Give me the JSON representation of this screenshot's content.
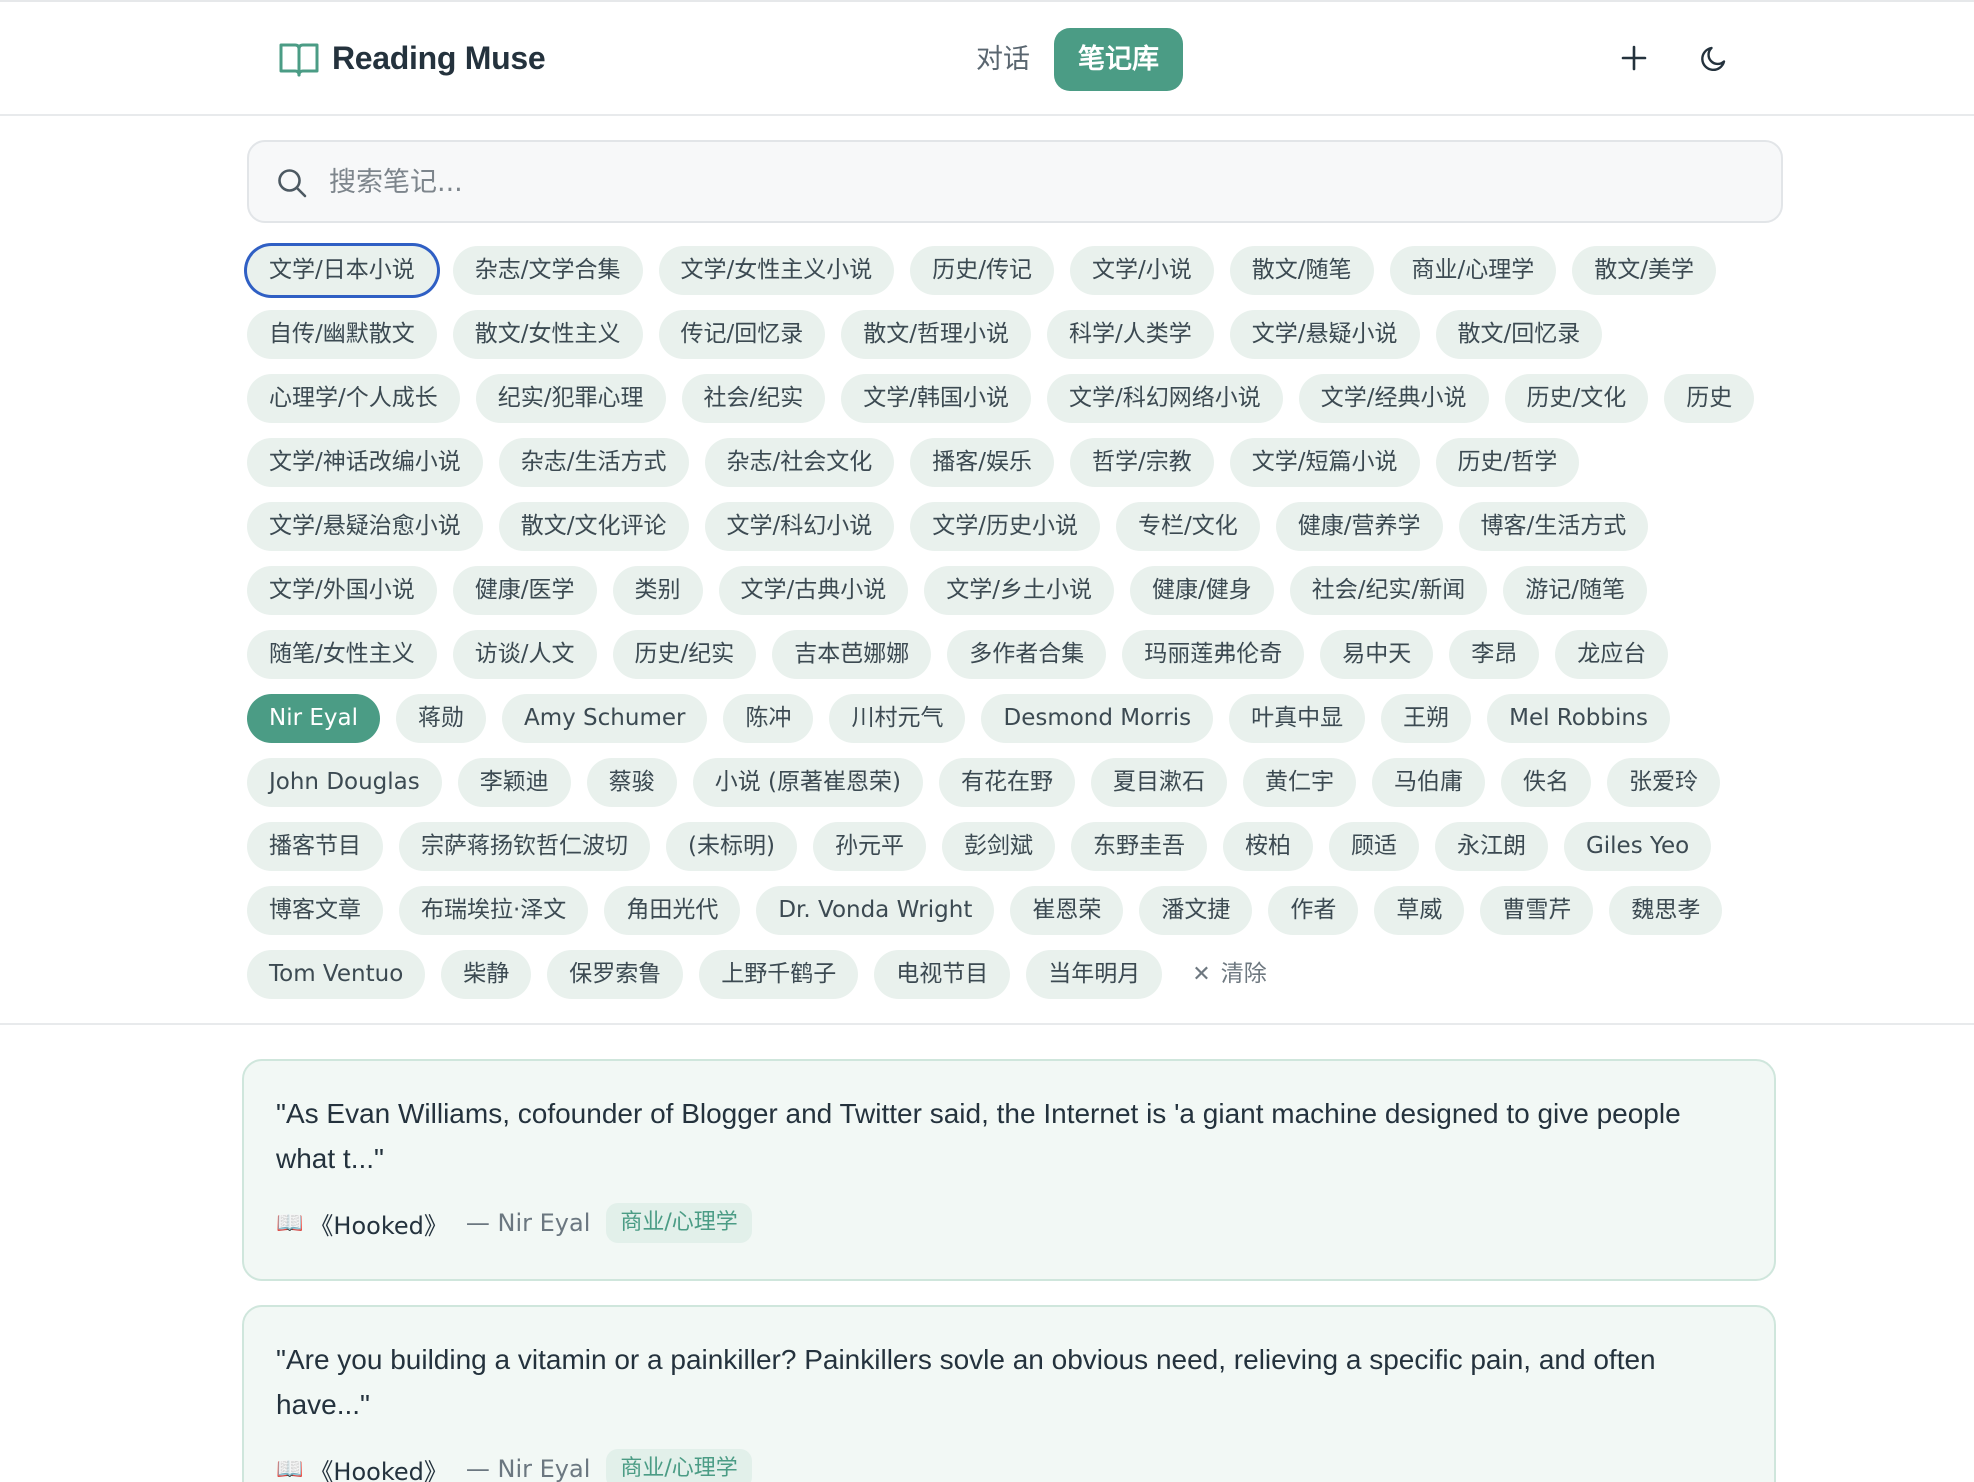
{
  "app": {
    "title": "Reading Muse"
  },
  "nav": {
    "chat": "对话",
    "notes": "笔记库"
  },
  "search": {
    "placeholder": "搜索笔记..."
  },
  "tags": [
    "文学/日本小说",
    "杂志/文学合集",
    "文学/女性主义小说",
    "历史/传记",
    "文学/小说",
    "散文/随笔",
    "商业/心理学",
    "散文/美学",
    "自传/幽默散文",
    "散文/女性主义",
    "传记/回忆录",
    "散文/哲理小说",
    "科学/人类学",
    "文学/悬疑小说",
    "散文/回忆录",
    "心理学/个人成长",
    "纪实/犯罪心理",
    "社会/纪实",
    "文学/韩国小说",
    "文学/科幻网络小说",
    "文学/经典小说",
    "历史/文化",
    "历史",
    "文学/神话改编小说",
    "杂志/生活方式",
    "杂志/社会文化",
    "播客/娱乐",
    "哲学/宗教",
    "文学/短篇小说",
    "历史/哲学",
    "文学/悬疑治愈小说",
    "散文/文化评论",
    "文学/科幻小说",
    "文学/历史小说",
    "专栏/文化",
    "健康/营养学",
    "博客/生活方式",
    "文学/外国小说",
    "健康/医学",
    "类别",
    "文学/古典小说",
    "文学/乡土小说",
    "健康/健身",
    "社会/纪实/新闻",
    "游记/随笔",
    "随笔/女性主义",
    "访谈/人文",
    "历史/纪实",
    "吉本芭娜娜",
    "多作者合集",
    "玛丽莲弗伦奇",
    "易中天",
    "李昂",
    "龙应台",
    "Nir Eyal",
    "蒋勋",
    "Amy Schumer",
    "陈冲",
    "川村元气",
    "Desmond Morris",
    "叶真中显",
    "王朔",
    "Mel Robbins",
    "John Douglas",
    "李颖迪",
    "蔡骏",
    "小说 (原著崔恩荣)",
    "有花在野",
    "夏目漱石",
    "黄仁宇",
    "马伯庸",
    "佚名",
    "张爱玲",
    "播客节目",
    "宗萨蒋扬钦哲仁波切",
    "(未标明)",
    "孙元平",
    "彭剑斌",
    "东野圭吾",
    "桉柏",
    "顾适",
    "永江朗",
    "Giles Yeo",
    "博客文章",
    "布瑞埃拉·泽文",
    "角田光代",
    "Dr. Vonda Wright",
    "崔恩荣",
    "潘文捷",
    "作者",
    "草威",
    "曹雪芹",
    "魏思孝",
    "Tom Ventuo",
    "柴静",
    "保罗索鲁",
    "上野千鹤子",
    "电视节目",
    "当年明月"
  ],
  "selected_tag": "Nir Eyal",
  "focused_tag": "文学/日本小说",
  "clear_label": "清除",
  "notes": [
    {
      "quote": "\"As Evan Williams, cofounder of Blogger and Twitter said, the Internet is 'a giant machine designed to give people what t...\"",
      "book": "《Hooked》",
      "author": "— Nir Eyal",
      "tag": "商业/心理学"
    },
    {
      "quote": "\"Are you building a vitamin or a painkiller? Painkillers sovle an obvious need, relieving a specific pain, and often have...\"",
      "book": "《Hooked》",
      "author": "— Nir Eyal",
      "tag": "商业/心理学"
    }
  ],
  "colors": {
    "accent": "#4b9c85",
    "tag_bg": "#e9f1ed",
    "card_bg": "#f2f8f5",
    "card_border": "#cfe6dc",
    "focus_ring": "#2f5fc4"
  },
  "icons": {
    "logo": "open-book-icon",
    "add": "plus-icon",
    "theme": "moon-icon",
    "search": "search-icon",
    "clear": "close-icon",
    "note_book": "book-icon"
  }
}
